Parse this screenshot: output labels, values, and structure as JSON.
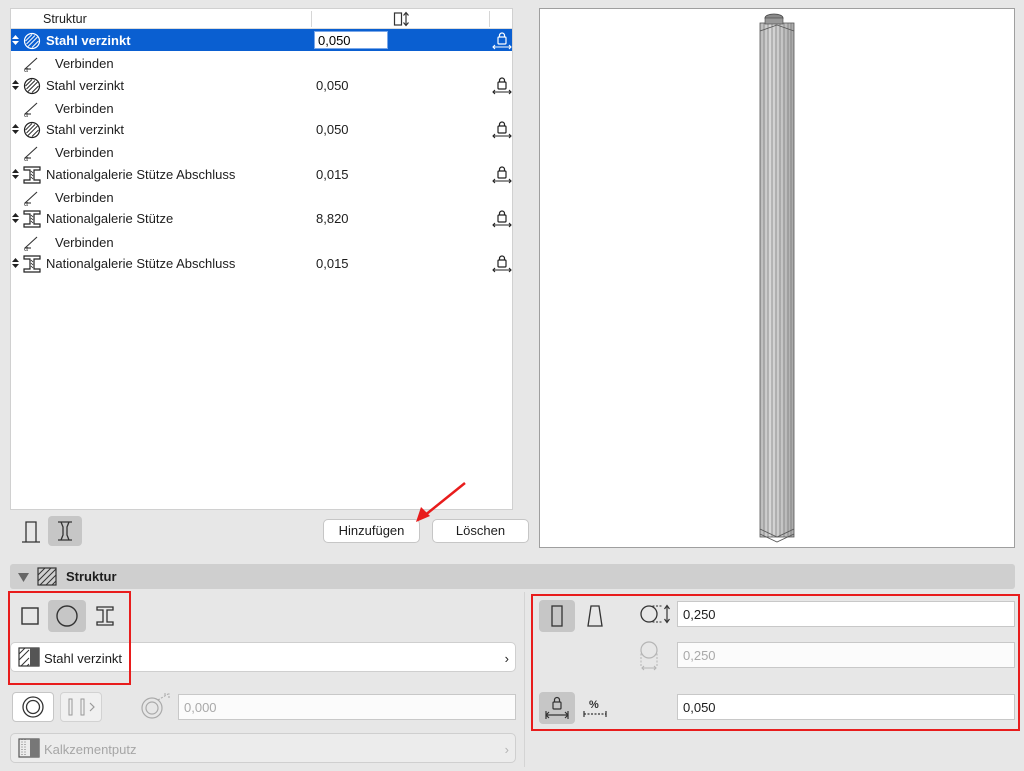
{
  "list": {
    "header_name": "Struktur",
    "rows": [
      {
        "kind": "main",
        "symbol": "circle-hatch-icon",
        "name": "Stahl verzinkt",
        "value": "0,050",
        "selected": true
      },
      {
        "kind": "sub",
        "name": "Verbinden"
      },
      {
        "kind": "main",
        "symbol": "circle-hatch-icon",
        "name": "Stahl verzinkt",
        "value": "0,050"
      },
      {
        "kind": "sub",
        "name": "Verbinden"
      },
      {
        "kind": "main",
        "symbol": "circle-hatch-icon",
        "name": "Stahl verzinkt",
        "value": "0,050"
      },
      {
        "kind": "sub",
        "name": "Verbinden"
      },
      {
        "kind": "main",
        "symbol": "i-beam-icon",
        "name": "Nationalgalerie Stütze Abschluss",
        "value": "0,015"
      },
      {
        "kind": "sub",
        "name": "Verbinden"
      },
      {
        "kind": "main",
        "symbol": "i-beam-icon",
        "name": "Nationalgalerie Stütze",
        "value": "8,820"
      },
      {
        "kind": "sub",
        "name": "Verbinden"
      },
      {
        "kind": "main",
        "symbol": "i-beam-icon",
        "name": "Nationalgalerie Stütze Abschluss",
        "value": "0,015"
      }
    ]
  },
  "buttons": {
    "add": "Hinzufügen",
    "delete": "Löschen"
  },
  "section": {
    "title": "Struktur"
  },
  "profile": {
    "building_material": "Stahl verzinkt",
    "veneer_thickness": "0,000",
    "veneer_material": "Kalkzementputz"
  },
  "dimensions": {
    "diameter": "0,250",
    "diameter_end": "0,250",
    "length": "0,050"
  },
  "colors": {
    "selection": "#0a5fd1",
    "annotation": "#e81c1c"
  }
}
